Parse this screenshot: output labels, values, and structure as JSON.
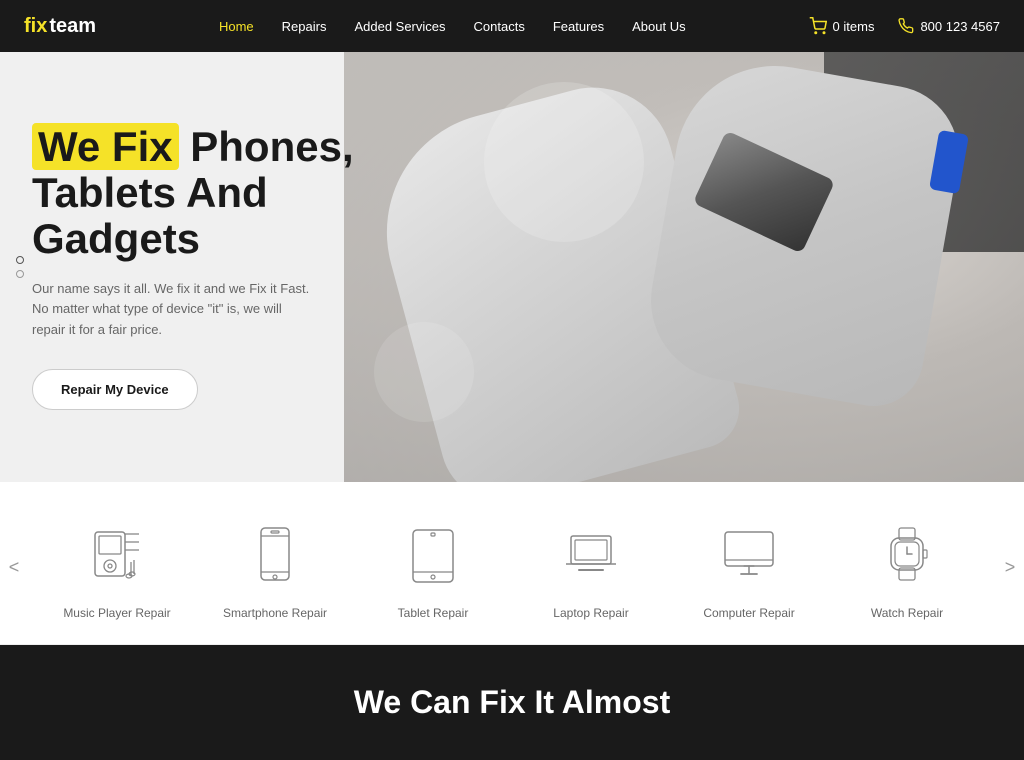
{
  "header": {
    "logo_fix": "fix",
    "logo_team": "team",
    "nav": [
      {
        "label": "Home",
        "active": true
      },
      {
        "label": "Repairs",
        "active": false
      },
      {
        "label": "Added Services",
        "active": false
      },
      {
        "label": "Contacts",
        "active": false
      },
      {
        "label": "Features",
        "active": false
      },
      {
        "label": "About Us",
        "active": false
      }
    ],
    "cart_label": "0 items",
    "phone_label": "800 123 4567"
  },
  "hero": {
    "title_highlight": "We Fix",
    "title_rest": " Phones,",
    "title_line2": "Tablets And",
    "title_line3": "Gadgets",
    "subtitle": "Our name says it all. We fix it and we Fix it Fast. No matter what type of device \"it\" is, we will repair it for a fair price.",
    "cta_label": "Repair My Device"
  },
  "services": {
    "prev_label": "<",
    "next_label": ">",
    "items": [
      {
        "id": "music",
        "label": "Music Player Repair",
        "icon": "music-player-icon"
      },
      {
        "id": "smartphone",
        "label": "Smartphone Repair",
        "icon": "smartphone-icon"
      },
      {
        "id": "tablet",
        "label": "Tablet Repair",
        "icon": "tablet-icon"
      },
      {
        "id": "laptop",
        "label": "Laptop Repair",
        "icon": "laptop-icon"
      },
      {
        "id": "computer",
        "label": "Computer Repair",
        "icon": "computer-icon"
      },
      {
        "id": "watch",
        "label": "Watch Repair",
        "icon": "watch-icon"
      }
    ]
  },
  "dark_section": {
    "heading": "We Can Fix It Almost"
  }
}
